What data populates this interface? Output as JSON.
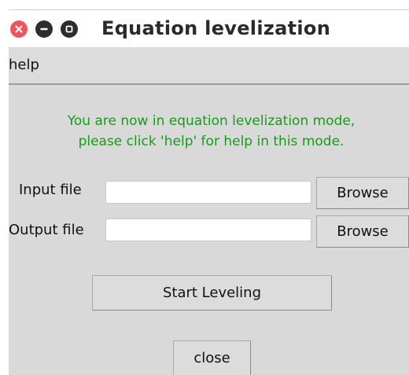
{
  "window": {
    "title": "Equation levelization",
    "controls": {
      "close": "close-icon",
      "minimize": "minimize-icon",
      "maximize": "maximize-icon"
    }
  },
  "menu": {
    "help_label": "help"
  },
  "info": {
    "line1": "You are now in equation levelization mode,",
    "line2": "please click 'help' for help in this mode.",
    "color": "#1a9a1a"
  },
  "form": {
    "input_label": "Input file",
    "input_value": "",
    "output_label": "Output file",
    "output_value": "",
    "browse_label": "Browse"
  },
  "actions": {
    "start_label": "Start Leveling",
    "close_label": "close"
  },
  "colors": {
    "close_button": "#f0545c",
    "window_bg": "#d9d9d9"
  }
}
